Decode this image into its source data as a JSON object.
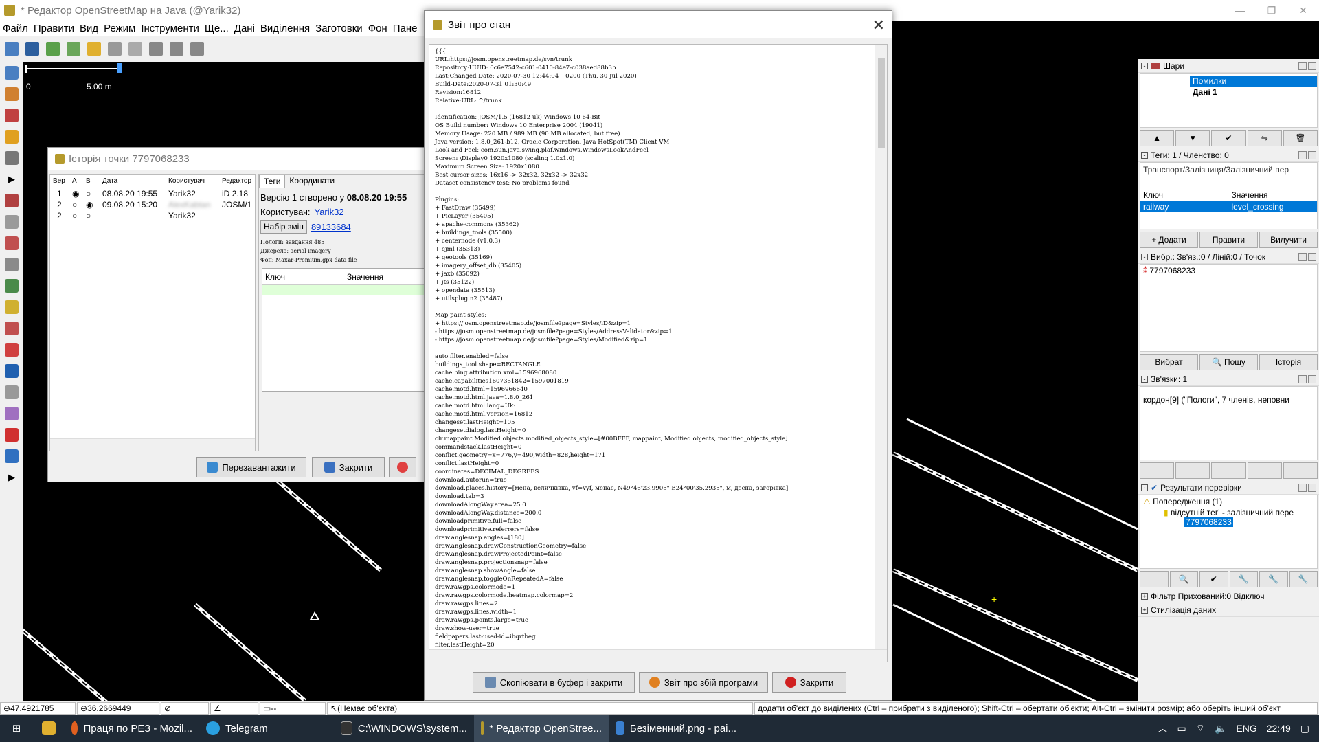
{
  "window": {
    "title": "* Редактор OpenStreetMap на Java (@Yarik32)",
    "controls": [
      "—",
      "❐",
      "✕"
    ]
  },
  "menu": [
    "Файл",
    "Правити",
    "Вид",
    "Режим",
    "Інструменти",
    "Ще...",
    "Дані",
    "Виділення",
    "Заготовки",
    "Фон",
    "Пане"
  ],
  "scale": {
    "zero": "0",
    "label": "5.00 m"
  },
  "history": {
    "title": "Історія точки 7797068233",
    "columns": [
      "Вер",
      "A",
      "B",
      "Дата",
      "Користувач",
      "Редактор"
    ],
    "rows": [
      {
        "ver": "1",
        "date": "08.08.20 19:55",
        "user": "Yarik32",
        "editor": "iD 2.18"
      },
      {
        "ver": "2",
        "date": "09.08.20 15:20",
        "user": "AlexKabtan",
        "editor": "JOSM/1"
      },
      {
        "ver": "2",
        "date": "",
        "user": "Yarik32",
        "editor": ""
      }
    ],
    "tabs": [
      "Теги",
      "Координати"
    ],
    "version_text": "Версію 1 створено у",
    "version_date": "08.08.20 19:55",
    "user_label": "Користувач:",
    "user_link": "Yarik32",
    "changeset_label": "Набір змін",
    "changeset_link": "89133684",
    "meta": [
      "Пологи: завдання 485",
      "Джерело: aerial imagery",
      "Фон: Maxar-Premium.gpx data file"
    ],
    "tag_key_header": "Ключ",
    "tag_value_header": "Значення",
    "reload_button": "Перезавантажити",
    "close_button": "Закрити"
  },
  "report": {
    "title": "Звіт про стан",
    "text": "{{{\nURL:https://josm.openstreetmap.de/svn/trunk\nRepository:UUID: 0c6e7542-c601-0410-84e7-c038aed88b3b\nLast:Changed Date: 2020-07-30 12:44:04 +0200 (Thu, 30 Jul 2020)\nBuild-Date:2020-07-31 01:30:49\nRevision:16812\nRelative:URL: ^/trunk\n\nIdentification: JOSM/1.5 (16812 uk) Windows 10 64-Bit\nOS Build number: Windows 10 Enterprise 2004 (19041)\nMemory Usage: 220 MB / 989 MB (90 MB allocated, but free)\nJava version: 1.8.0_261-b12, Oracle Corporation, Java HotSpot(TM) Client VM\nLook and Feel: com.sun.java.swing.plaf.windows.WindowsLookAndFeel\nScreen: \\Display0 1920x1080 (scaling 1.0x1.0)\nMaximum Screen Size: 1920x1080\nBest cursor sizes: 16x16 -> 32x32, 32x32 -> 32x32\nDataset consistency test: No problems found\n\nPlugins:\n+ FastDraw (35499)\n+ PicLayer (35405)\n+ apache-commons (35362)\n+ buildings_tools (35500)\n+ centernode (v1.0.3)\n+ ejml (35313)\n+ geotools (35169)\n+ imagery_offset_db (35405)\n+ jaxb (35092)\n+ jts (35122)\n+ opendata (35513)\n+ utilsplugin2 (35487)\n\nMap paint styles:\n+ https://josm.openstreetmap.de/josmfile?page=Styles/iD&zip=1\n- https://josm.openstreetmap.de/josmfile?page=Styles/AddressValidator&zip=1\n- https://josm.openstreetmap.de/josmfile?page=Styles/Modified&zip=1\n\nauto.filter.enabled=false\nbuildings_tool.shape=RECTANGLE\ncache.bing.attribution.xml=1596968080\ncache.capabilities1607351842=1597001819\ncache.motd.html=1596966640\ncache.motd.html.java=1.8.0_261\ncache.motd.html.lang=Uk:\ncache.motd.html.version=16812\nchangeset.lastHeight=105\nchangesetdialog.lastHeight=0\nclr.mappaint.Modified objects.modified_objects_style=[#00BFFF, mappaint, Modified objects, modified_objects_style]\ncommandstack.lastHeight=0\nconflict.geometry=x=776,y=490,width=828,height=171\nconflict.lastHeight=0\ncoordinates=DECIMAL_DEGREES\ndownload.autorun=true\ndownload.places.history=[мена, величківка, vf=vyf, менас, N49°46'23.9905\" E24°00'35.2935\", м, десна, загорівка]\ndownload.tab=3\ndownloadAlongWay.area=25.0\ndownloadAlongWay.distance=200.0\ndownloadprimitive.full=false\ndownloadprimitive.referrers=false\ndraw.anglesnap.angles=[180]\ndraw.anglesnap.drawConstructionGeometry=false\ndraw.anglesnap.drawProjectedPoint=false\ndraw.anglesnap.projectionsnap=false\ndraw.anglesnap.showAngle=false\ndraw.anglesnap.toggleOnRepeatedA=false\ndraw.rawgps.colormode=1\ndraw.rawgps.colormode.heatmap.colormap=2\ndraw.rawgps.lines=2\ndraw.rawgps.lines.width=1\ndraw.rawgps.points.large=true\ndraw.show-user=true\nfieldpapers.last-used-id=ibqrtbeg\nfilter.lastHeight=20",
    "copy_button": "Скопіювати в буфер і закрити",
    "bug_button": "Звіт про збій програми",
    "close_button": "Закрити"
  },
  "panels": {
    "layers": {
      "title": "Шари",
      "items": [
        "Помилки",
        "Дані 1"
      ]
    },
    "tags": {
      "title": "Теги: 1 / Членство: 0",
      "preset": "Транспорт/Залізниця/Залізничний пер",
      "key_header": "Ключ",
      "value_header": "Значення",
      "key": "railway",
      "value": "level_crossing",
      "add": "Додати",
      "edit": "Правити",
      "delete": "Вилучити"
    },
    "selection": {
      "title": "Вибр.: Зв'яз.:0 / Ліній:0 / Точок",
      "item": "7797068233",
      "select": "Вибрат",
      "search": "Пошу",
      "history": "Історія"
    },
    "relations": {
      "title": "Зв'язки: 1",
      "item": "кордон[9] (\"Пологи\", 7 членів, неповни"
    },
    "validation": {
      "title": "Результати перевірки",
      "warnings": "Попередження (1)",
      "issue": "відсутній тег' - залізничний пере",
      "node": "7797068233"
    },
    "filter": {
      "title": "Фільтр Прихований:0 Відключ"
    },
    "styles": {
      "title": "Стилізація даних"
    }
  },
  "status": {
    "lat": "47.4921785",
    "lon": "36.2669449",
    "dash": "--",
    "object": "(Немає об'єкта)",
    "help": "додати об'єкт до виділених (Ctrl – прибрати з виділеного); Shift-Ctrl – обертати об'єкти; Alt-Ctrl – змінити розмір; або оберіть інший об'єкт"
  },
  "taskbar": {
    "firefox": "Праця по РЕЗ - Mozil...",
    "telegram": "Telegram",
    "cmd": "C:\\WINDOWS\\system...",
    "josm": "* Редактор OpenStree...",
    "paint": "Безіменний.png - pai...",
    "lang": "ENG",
    "time": "22:49"
  },
  "colors": {
    "accent": "#0078d7",
    "taskbar": "#1f2a36",
    "map": "#000000"
  }
}
